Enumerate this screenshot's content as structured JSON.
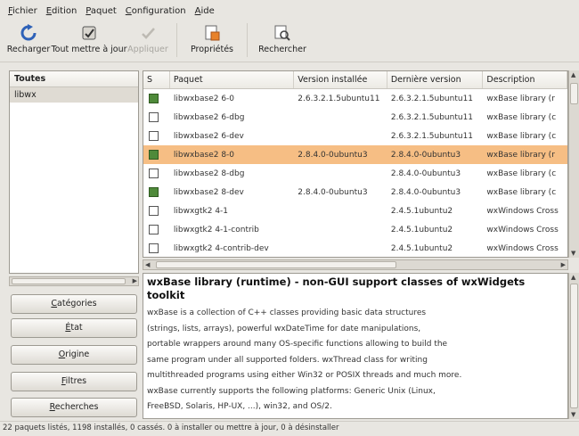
{
  "menubar": {
    "items": [
      {
        "first": "F",
        "rest": "ichier"
      },
      {
        "first": "E",
        "rest": "dition"
      },
      {
        "first": "P",
        "rest": "aquet"
      },
      {
        "first": "C",
        "rest": "onfiguration"
      },
      {
        "first": "A",
        "rest": "ide"
      }
    ]
  },
  "toolbar": {
    "reload_label": "Recharger",
    "upgrade_all_label": "Tout mettre à jour",
    "apply_label": "Appliquer",
    "properties_label": "Propriétés",
    "search_label": "Rechercher"
  },
  "left_panel": {
    "header": "Toutes",
    "items": [
      "libwx"
    ]
  },
  "filter_buttons": [
    {
      "first": "C",
      "rest": "atégories"
    },
    {
      "first": "É",
      "rest": "tat"
    },
    {
      "first": "O",
      "rest": "rigine"
    },
    {
      "first": "F",
      "rest": "iltres"
    },
    {
      "first": "R",
      "rest": "echerches"
    }
  ],
  "packages": {
    "columns": [
      "S",
      "Paquet",
      "Version installée",
      "Dernière version",
      "Description"
    ],
    "rows": [
      {
        "checked": true,
        "selected": false,
        "name": "libwxbase2 6-0",
        "installed": "2.6.3.2.1.5ubuntu11",
        "latest": "2.6.3.2.1.5ubuntu11",
        "desc": "wxBase library (r"
      },
      {
        "checked": false,
        "selected": false,
        "name": "libwxbase2 6-dbg",
        "installed": "",
        "latest": "2.6.3.2.1.5ubuntu11",
        "desc": "wxBase library (c"
      },
      {
        "checked": false,
        "selected": false,
        "name": "libwxbase2 6-dev",
        "installed": "",
        "latest": "2.6.3.2.1.5ubuntu11",
        "desc": "wxBase library (c"
      },
      {
        "checked": true,
        "selected": true,
        "name": "libwxbase2 8-0",
        "installed": "2.8.4.0-0ubuntu3",
        "latest": "2.8.4.0-0ubuntu3",
        "desc": "wxBase library (r"
      },
      {
        "checked": false,
        "selected": false,
        "name": "libwxbase2 8-dbg",
        "installed": "",
        "latest": "2.8.4.0-0ubuntu3",
        "desc": "wxBase library (c"
      },
      {
        "checked": true,
        "selected": false,
        "name": "libwxbase2 8-dev",
        "installed": "2.8.4.0-0ubuntu3",
        "latest": "2.8.4.0-0ubuntu3",
        "desc": "wxBase library (c"
      },
      {
        "checked": false,
        "selected": false,
        "name": "libwxgtk2 4-1",
        "installed": "",
        "latest": "2.4.5.1ubuntu2",
        "desc": "wxWindows Cross"
      },
      {
        "checked": false,
        "selected": false,
        "name": "libwxgtk2 4-1-contrib",
        "installed": "",
        "latest": "2.4.5.1ubuntu2",
        "desc": "wxWindows Cross"
      },
      {
        "checked": false,
        "selected": false,
        "name": "libwxgtk2 4-contrib-dev",
        "installed": "",
        "latest": "2.4.5.1ubuntu2",
        "desc": "wxWindows Cross"
      }
    ]
  },
  "description": {
    "title": "wxBase library (runtime) - non-GUI support classes of wxWidgets toolkit",
    "lines": [
      "wxBase is a collection of C++ classes providing basic data structures",
      "(strings, lists, arrays), powerful wxDateTime for date manipulations,",
      "portable wrappers around many OS-specific functions allowing to build the",
      "same program under all supported folders. wxThread class for writing",
      "multithreaded programs using either Win32 or POSIX threads and much more.",
      "wxBase currently supports the following platforms: Generic Unix (Linux,",
      "FreeBSD, Solaris, HP-UX, ...), win32, and OS/2."
    ]
  },
  "statusbar": {
    "text": "22 paquets listés, 1198 installés, 0 cassés. 0 à installer ou mettre à jour, 0 à désinstaller"
  },
  "colors": {
    "selected_row": "#f6be84",
    "checked_box": "#4f8a3a",
    "window_bg": "#e8e6e1"
  }
}
